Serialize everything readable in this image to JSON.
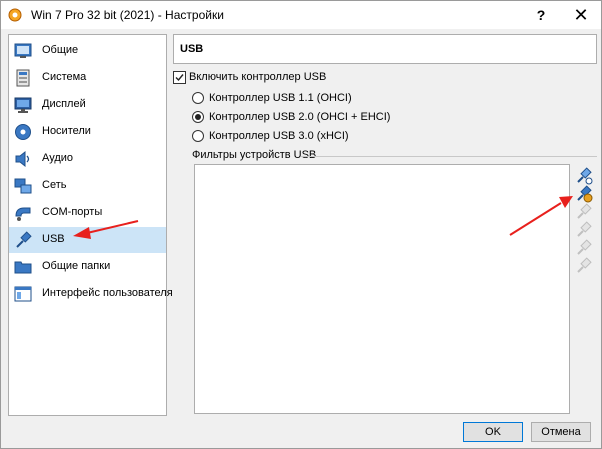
{
  "window": {
    "title": "Win 7 Pro 32 bit (2021) - Настройки",
    "help_glyph": "?",
    "close_glyph": "✕"
  },
  "sidebar": {
    "items": [
      {
        "label": "Общие",
        "icon": "general-settings-icon",
        "active": false
      },
      {
        "label": "Система",
        "icon": "system-board-icon",
        "active": false
      },
      {
        "label": "Дисплей",
        "icon": "display-monitor-icon",
        "active": false
      },
      {
        "label": "Носители",
        "icon": "storage-disk-icon",
        "active": false
      },
      {
        "label": "Аудио",
        "icon": "audio-speaker-icon",
        "active": false
      },
      {
        "label": "Сеть",
        "icon": "network-icon",
        "active": false
      },
      {
        "label": "COM-порты",
        "icon": "serial-port-icon",
        "active": false
      },
      {
        "label": "USB",
        "icon": "usb-icon",
        "active": true
      },
      {
        "label": "Общие папки",
        "icon": "shared-folder-icon",
        "active": false
      },
      {
        "label": "Интерфейс пользователя",
        "icon": "user-interface-icon",
        "active": false
      }
    ]
  },
  "main": {
    "header_title": "USB",
    "enable_usb": {
      "label": "Включить контроллер USB",
      "checked": true
    },
    "controllers": [
      {
        "label": "Контроллер USB 1.1 (OHCI)",
        "selected": false
      },
      {
        "label": "Контроллер USB 2.0 (OHCI + EHCI)",
        "selected": true
      },
      {
        "label": "Контроллер USB 3.0 (xHCI)",
        "selected": false
      }
    ],
    "filters_label": "Фильтры устройств USB",
    "filter_tools": [
      {
        "icon": "add-empty-filter-icon",
        "enabled": true
      },
      {
        "icon": "add-filter-from-device-icon",
        "enabled": true
      },
      {
        "icon": "edit-filter-icon",
        "enabled": false
      },
      {
        "icon": "remove-filter-icon",
        "enabled": false
      },
      {
        "icon": "move-filter-up-icon",
        "enabled": false
      },
      {
        "icon": "move-filter-down-icon",
        "enabled": false
      }
    ]
  },
  "buttons": {
    "ok": "OK",
    "cancel": "Отмена"
  },
  "colors": {
    "selection": "#cce4f7",
    "annotation_arrow": "#e8201d",
    "ok_border": "#0078d7"
  }
}
